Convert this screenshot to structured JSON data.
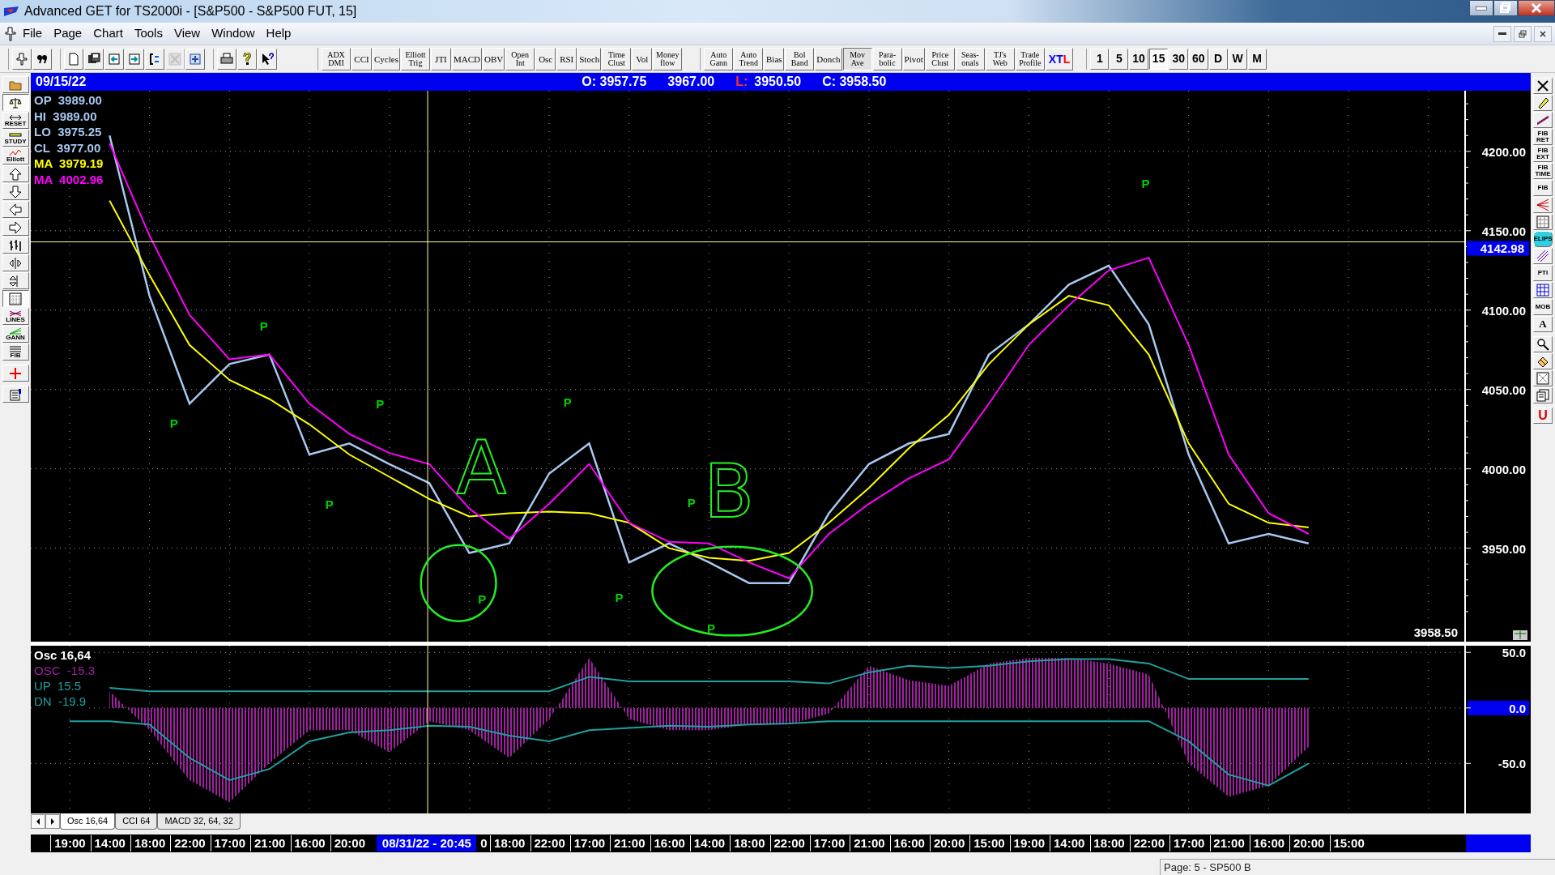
{
  "window": {
    "title": "Advanced GET for TS2000i - [S&P500 - S&P500 FUT, 15]"
  },
  "menu": [
    "File",
    "Page",
    "Chart",
    "Tools",
    "View",
    "Window",
    "Help"
  ],
  "toolbar": {
    "icon_groups": [
      [
        {
          "disabled": false
        },
        {
          "disabled": false
        }
      ],
      [
        {
          "disabled": false
        },
        {
          "disabled": false
        },
        {
          "disabled": false
        },
        {
          "disabled": false
        },
        {
          "disabled": false
        },
        {
          "disabled": true
        },
        {
          "disabled": false
        }
      ],
      [
        {
          "disabled": false
        },
        {
          "disabled": false
        },
        {
          "disabled": false
        }
      ]
    ],
    "study_buttons": [
      {
        "label": "ADX DMI",
        "pressed": false
      },
      {
        "label": "CCI",
        "pressed": false
      },
      {
        "label": "Cycles",
        "pressed": false
      },
      {
        "label": "Elliott Trig",
        "pressed": false
      },
      {
        "label": "JTI",
        "pressed": false
      },
      {
        "label": "MACD",
        "pressed": false
      },
      {
        "label": "OBV",
        "pressed": false
      },
      {
        "label": "Open Int",
        "pressed": false
      },
      {
        "label": "Osc",
        "pressed": false
      },
      {
        "label": "RSI",
        "pressed": false
      },
      {
        "label": "Stoch",
        "pressed": false
      },
      {
        "label": "Time Clust",
        "pressed": false
      },
      {
        "label": "Vol",
        "pressed": false
      },
      {
        "label": "Money flow",
        "pressed": false
      }
    ],
    "overlay_buttons": [
      {
        "label": "Auto Gann",
        "pressed": false
      },
      {
        "label": "Auto Trend",
        "pressed": false
      },
      {
        "label": "Bias",
        "pressed": false
      },
      {
        "label": "Bol Band",
        "pressed": false
      },
      {
        "label": "Donch",
        "pressed": false
      },
      {
        "label": "Mov Ave",
        "pressed": true
      },
      {
        "label": "Para-bolic",
        "pressed": false
      },
      {
        "label": "Pivot",
        "pressed": false
      },
      {
        "label": "Price Clust",
        "pressed": false
      },
      {
        "label": "Seas-onals",
        "pressed": false
      },
      {
        "label": "TJ's Web",
        "pressed": false
      },
      {
        "label": "Trade Profile",
        "pressed": false
      }
    ],
    "xtl_button": [
      {
        "text": "XT",
        "color": "#0000ff"
      },
      {
        "text": "L",
        "color": "#ff0000"
      }
    ],
    "intervals": [
      {
        "label": "1",
        "selected": false
      },
      {
        "label": "5",
        "selected": false
      },
      {
        "label": "10",
        "selected": false
      },
      {
        "label": "15",
        "selected": true
      },
      {
        "label": "30",
        "selected": false
      },
      {
        "label": "60",
        "selected": false
      },
      {
        "label": "D",
        "selected": false
      },
      {
        "label": "W",
        "selected": false
      },
      {
        "label": "M",
        "selected": false
      }
    ]
  },
  "info_bar": {
    "date": "09/15/22",
    "open": "O: 3957.75",
    "high": "3967.00",
    "low_label": "L:",
    "low": "3950.50",
    "close": "C: 3958.50"
  },
  "left_tools": [
    {
      "pressed": false
    },
    {
      "pressed": true
    },
    {
      "label": "RESET",
      "pressed": false
    },
    {
      "label": "STUDY",
      "pressed": false
    },
    {
      "label": "Elliott",
      "pressed": false
    },
    {
      "pressed": false
    },
    {
      "pressed": false
    },
    {
      "pressed": false
    },
    {
      "pressed": false
    },
    {
      "pressed": false
    },
    {
      "pressed": false
    },
    {
      "pressed": false
    },
    {
      "pressed": true
    },
    {
      "label": "LINES",
      "pressed": false
    },
    {
      "label": "GANN",
      "pressed": false
    },
    {
      "label": "FIB",
      "pressed": false
    },
    {
      "pressed": false
    },
    {
      "pressed": false
    }
  ],
  "right_tools": [
    {
      "pressed": false
    },
    {
      "pressed": false
    },
    {
      "pressed": false
    },
    {
      "label": "FIB RET",
      "pressed": false
    },
    {
      "label": "FIB EXT",
      "pressed": false
    },
    {
      "label": "FIB TIME",
      "pressed": false
    },
    {
      "label": "FIB",
      "pressed": false
    },
    {
      "pressed": false
    },
    {
      "pressed": false
    },
    {
      "label": "ELIPS",
      "pressed": false
    },
    {
      "pressed": false
    },
    {
      "label": "PTI",
      "pressed": false
    },
    {
      "pressed": false
    },
    {
      "label": "MOB",
      "pressed": false
    },
    {
      "label": "A",
      "pressed": false
    },
    {
      "pressed": false
    },
    {
      "pressed": false
    },
    {
      "pressed": false
    },
    {
      "pressed": false
    },
    {
      "label": "U",
      "pressed": false
    }
  ],
  "price_pane": {
    "legend": [
      {
        "label": "OP",
        "value": "3989.00"
      },
      {
        "label": "HI",
        "value": "3989.00"
      },
      {
        "label": "LO",
        "value": "3975.25"
      },
      {
        "label": "CL",
        "value": "3977.00"
      }
    ],
    "ma_values": [
      "3979.19",
      "4002.96"
    ],
    "last_price": "3958.50",
    "ink_notes": [
      "A",
      "B"
    ],
    "chart_data": {
      "type": "line",
      "categories": [
        null,
        null,
        null,
        null,
        null,
        null,
        null,
        null,
        null,
        null,
        null,
        null,
        null,
        null,
        null,
        null,
        null,
        null,
        null,
        null,
        null,
        null,
        null,
        null,
        null,
        null,
        null,
        null,
        null,
        null,
        null,
        null
      ],
      "grid": true,
      "ylim": [
        3891.1,
        4238.2
      ],
      "ref_lines": [
        {
          "axis": "y",
          "value": 4142.98,
          "label": "4142.98"
        }
      ],
      "yticks": [
        {
          "value": 3950,
          "label": "3950.00"
        },
        {
          "value": 4000,
          "label": "4000.00"
        },
        {
          "value": 4050,
          "label": "4050.00"
        },
        {
          "value": 4100,
          "label": "4100.00"
        },
        {
          "value": 4150,
          "label": "4150.00"
        },
        {
          "value": 4200,
          "label": "4200.00"
        }
      ],
      "series": [
        {
          "color": "#a8c8f0",
          "values": [
            null,
            4210,
            4109,
            4041,
            4066,
            4072,
            4009,
            4016,
            4003,
            3991,
            3947,
            3953,
            3997,
            4016,
            3941,
            3953,
            3941,
            3928,
            3928,
            3972,
            4003,
            4016,
            4022,
            4072,
            4091,
            4116,
            4128,
            4091,
            4009,
            3953,
            3959,
            3953
          ]
        },
        {
          "name": "MA",
          "color": "#ffff00",
          "values": [
            null,
            4169,
            4122,
            4078,
            4056,
            4044,
            4028,
            4009,
            3995,
            3981,
            3970,
            3972,
            3973,
            3972,
            3966,
            3950,
            3944,
            3942,
            3947,
            3966,
            3988,
            4013,
            4034,
            4066,
            4091,
            4109,
            4103,
            4072,
            4016,
            3978,
            3966,
            3963
          ]
        },
        {
          "name": "MA",
          "color": "#ff00ff",
          "values": [
            null,
            4205,
            4147,
            4097,
            4069,
            4072,
            4041,
            4022,
            4010,
            4003,
            3975,
            3956,
            3978,
            4003,
            3966,
            3954,
            3953,
            3941,
            3931,
            3959,
            3978,
            3994,
            4006,
            4041,
            4078,
            4103,
            4125,
            4133,
            4078,
            4009,
            3972,
            3959
          ]
        }
      ],
      "annotations": [
        "P",
        "P",
        "P",
        "P",
        "P",
        "P",
        "P",
        "P",
        "P",
        "P"
      ]
    }
  },
  "osc_pane": {
    "title": "Osc 16,64",
    "legend_values": [
      "-15.3",
      "15.5",
      "-19.9"
    ],
    "chart_data": {
      "type": "line",
      "categories": [
        null,
        null,
        null,
        null,
        null,
        null,
        null,
        null,
        null,
        null,
        null,
        null,
        null,
        null,
        null,
        null,
        null,
        null,
        null,
        null,
        null,
        null,
        null,
        null,
        null,
        null,
        null,
        null,
        null,
        null,
        null,
        null
      ],
      "grid": true,
      "ylim": [
        -95,
        56
      ],
      "yticks": [
        {
          "value": 50,
          "label": "50.0"
        },
        {
          "value": 0,
          "label": "0.0"
        },
        {
          "value": -50,
          "label": "-50.0"
        }
      ],
      "series": [
        {
          "name": "OSC",
          "type": "area",
          "color": "#a020a0",
          "values": [
            null,
            15,
            -20,
            -65,
            -85,
            -50,
            -20,
            -20,
            -40,
            -12,
            -20,
            -45,
            -10,
            45,
            -10,
            -20,
            -20,
            -15,
            -15,
            -5,
            38,
            25,
            20,
            40,
            45,
            45,
            40,
            30,
            -50,
            -80,
            -70,
            -35
          ]
        },
        {
          "name": "UP",
          "color": "#20a0a0",
          "values": [
            null,
            18,
            15,
            15,
            15,
            15,
            15,
            15,
            15,
            15,
            15,
            15,
            15,
            28,
            24,
            24,
            24,
            24,
            24,
            22,
            32,
            38,
            36,
            38,
            42,
            44,
            44,
            40,
            26,
            26,
            26,
            26
          ]
        },
        {
          "name": "DN",
          "color": "#20a0a0",
          "values": [
            -12,
            -12,
            -15,
            -45,
            -65,
            -55,
            -30,
            -22,
            -20,
            -16,
            -17,
            -25,
            -30,
            -20,
            -18,
            -16,
            -17,
            -15,
            -14,
            -12,
            -12,
            -12,
            -12,
            -12,
            -12,
            -12,
            -12,
            -12,
            -30,
            -60,
            -70,
            -50
          ]
        }
      ]
    }
  },
  "pane_tabs": [
    {
      "label": "Osc 16,64",
      "selected": true
    },
    {
      "label": "CCI 64",
      "selected": false
    },
    {
      "label": "MACD 32, 64, 32",
      "selected": false
    }
  ],
  "time_axis": [
    {
      "kind": "time",
      "text": "19:00"
    },
    {
      "kind": "time",
      "text": "14:00"
    },
    {
      "kind": "time",
      "text": "18:00"
    },
    {
      "kind": "time",
      "text": "22:00"
    },
    {
      "kind": "time",
      "text": "17:00"
    },
    {
      "kind": "time",
      "text": "21:00"
    },
    {
      "kind": "time",
      "text": "16:00"
    },
    {
      "kind": "time",
      "text": "20:00"
    },
    {
      "kind": "cursor",
      "text": "08/31/22 - 20:45"
    },
    {
      "kind": "clipped",
      "text": "0"
    },
    {
      "kind": "time",
      "text": "18:00"
    },
    {
      "kind": "time",
      "text": "22:00"
    },
    {
      "kind": "time",
      "text": "17:00"
    },
    {
      "kind": "time",
      "text": "21:00"
    },
    {
      "kind": "time",
      "text": "16:00"
    },
    {
      "kind": "time",
      "text": "14:00"
    },
    {
      "kind": "time",
      "text": "18:00"
    },
    {
      "kind": "time",
      "text": "22:00"
    },
    {
      "kind": "time",
      "text": "17:00"
    },
    {
      "kind": "time",
      "text": "21:00"
    },
    {
      "kind": "time",
      "text": "16:00"
    },
    {
      "kind": "time",
      "text": "20:00"
    },
    {
      "kind": "time",
      "text": "15:00"
    },
    {
      "kind": "time",
      "text": "19:00"
    },
    {
      "kind": "time",
      "text": "14:00"
    },
    {
      "kind": "time",
      "text": "18:00"
    },
    {
      "kind": "time",
      "text": "22:00"
    },
    {
      "kind": "time",
      "text": "17:00"
    },
    {
      "kind": "time",
      "text": "21:00"
    },
    {
      "kind": "time",
      "text": "16:00"
    },
    {
      "kind": "time",
      "text": "20:00"
    },
    {
      "kind": "time",
      "text": "15:00"
    }
  ],
  "status_bar": "Page: 5 - SP500 B"
}
